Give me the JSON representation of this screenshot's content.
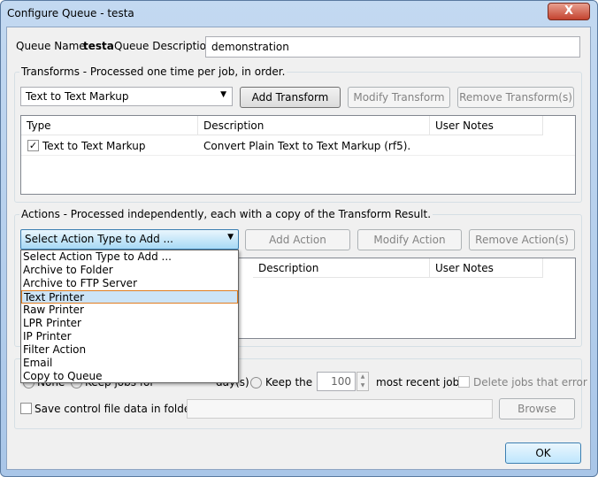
{
  "window": {
    "title": "Configure Queue - testa",
    "close_label": "X"
  },
  "queue": {
    "name_label": "Queue Name",
    "name": "testa",
    "desc_label": "Queue Description",
    "desc_value": "demonstration"
  },
  "transforms": {
    "group_label": "Transforms - Processed one time per job, in order.",
    "selected": "Text to Text Markup",
    "add": "Add Transform",
    "modify": "Modify Transform",
    "remove": "Remove Transform(s)",
    "columns": [
      "Type",
      "Description",
      "User Notes"
    ],
    "rows": [
      {
        "type": "Text to Text Markup",
        "checked": true,
        "description": "Convert Plain Text to Text Markup (rf5).",
        "notes": ""
      }
    ]
  },
  "actions": {
    "group_label": "Actions - Processed independently, each with a copy of the Transform Result.",
    "selected": "Select Action Type to Add ...",
    "add": "Add Action",
    "modify": "Modify Action",
    "remove": "Remove Action(s)",
    "columns": [
      "Description",
      "User Notes"
    ],
    "options": [
      "Select Action Type to Add ...",
      "Archive to Folder",
      "Archive to FTP Server",
      "Text Printer",
      "Raw Printer",
      "LPR Printer",
      "IP Printer",
      "Filter Action",
      "Email",
      "Copy to Queue"
    ],
    "highlighted": "Text Printer"
  },
  "retention": {
    "none": "None",
    "keep_for": "Keep jobs for",
    "days": "day(s)",
    "keep_the": "Keep the",
    "count": "100",
    "recent": "most recent jobs",
    "delete_err": "Delete jobs that error"
  },
  "save": {
    "label": "Save control file data in folder:",
    "folder": "",
    "browse": "Browse"
  },
  "ok": "OK"
}
